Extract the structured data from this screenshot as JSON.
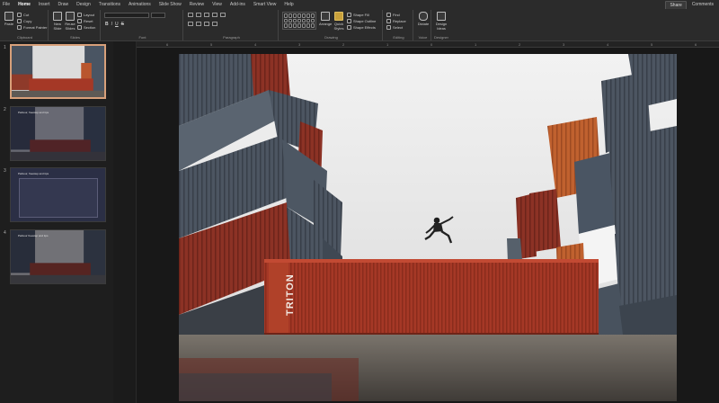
{
  "menu": {
    "items": [
      "File",
      "Home",
      "Insert",
      "Draw",
      "Design",
      "Transitions",
      "Animations",
      "Slide Show",
      "Review",
      "View",
      "Add-ins",
      "Smart View",
      "Help"
    ],
    "active_index": 1,
    "share_label": "Share",
    "comments_label": "Comments"
  },
  "ribbon": {
    "clipboard": {
      "paste_label": "Paste",
      "cut_label": "Cut",
      "copy_label": "Copy",
      "format_painter_label": "Format Painter",
      "group_label": "Clipboard"
    },
    "slides": {
      "new_slide_label": "New Slide",
      "reuse_slides_label": "Reuse Slides",
      "layout_label": "Layout",
      "reset_label": "Reset",
      "section_label": "Section",
      "group_label": "Slides"
    },
    "font": {
      "bold": "B",
      "italic": "I",
      "underline": "U",
      "strike": "S",
      "group_label": "Font"
    },
    "paragraph": {
      "group_label": "Paragraph"
    },
    "drawing": {
      "arrange_label": "Arrange",
      "quick_styles_label": "Quick Styles",
      "shape_fill_label": "Shape Fill",
      "shape_outline_label": "Shape Outline",
      "shape_effects_label": "Shape Effects",
      "group_label": "Drawing"
    },
    "editing": {
      "find_label": "Find",
      "replace_label": "Replace",
      "select_label": "Select",
      "group_label": "Editing"
    },
    "voice": {
      "dictate_label": "Dictate",
      "group_label": "Voice"
    },
    "designer": {
      "design_ideas_label": "Design Ideas",
      "group_label": "Designer"
    }
  },
  "ruler": {
    "ticks": [
      "6",
      "5",
      "4",
      "3",
      "2",
      "1",
      "0",
      "1",
      "2",
      "3",
      "4",
      "5",
      "6"
    ]
  },
  "thumbnails": [
    {
      "number": "1",
      "title": ""
    },
    {
      "number": "2",
      "title": "Parkour, freestep and tips"
    },
    {
      "number": "3",
      "title": "Parkour, freestep and tips"
    },
    {
      "number": "4",
      "title": "Parkour freestep and tips"
    }
  ],
  "slide": {
    "container_text": "TRITON"
  },
  "colors": {
    "accent": "#d35230",
    "selected_thumb_border": "#d8a07a",
    "container_red": "#a83a26"
  }
}
